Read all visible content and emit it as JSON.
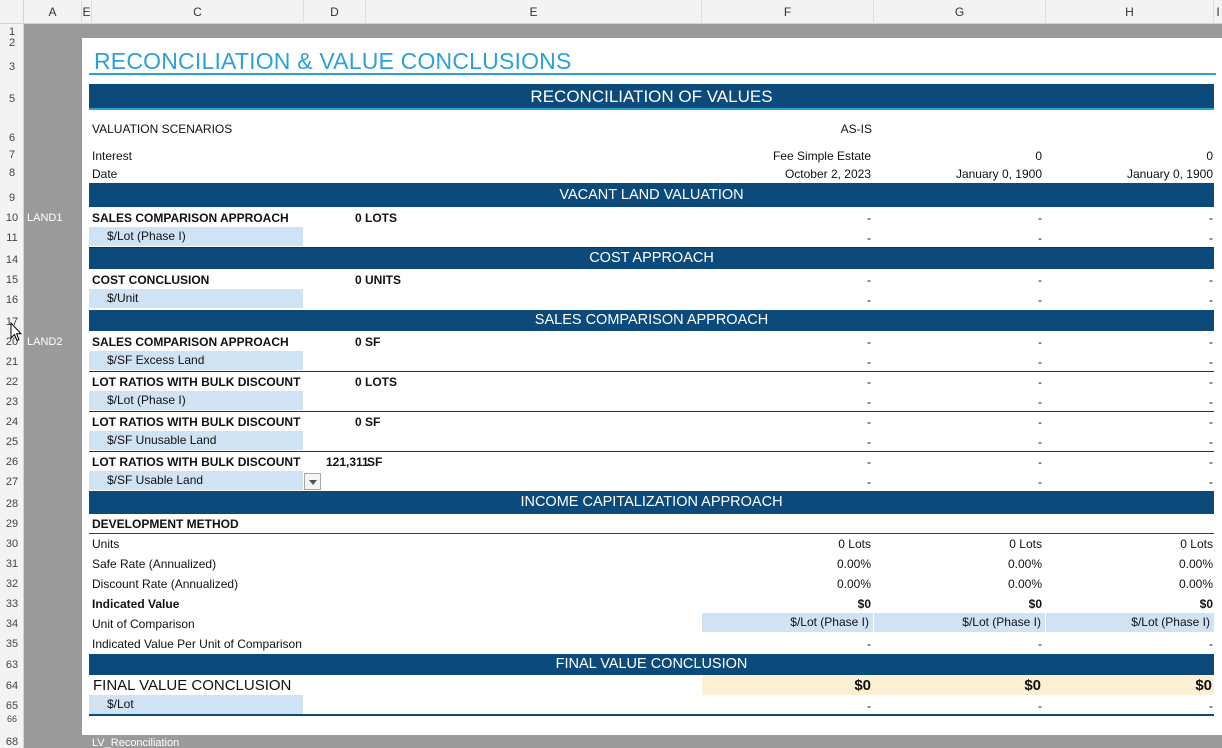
{
  "columns": [
    "A",
    "E",
    "C",
    "D",
    "E",
    "F",
    "G",
    "H",
    "I"
  ],
  "rows": [
    "1",
    "2",
    "3",
    "5",
    "6",
    "7",
    "8",
    "9",
    "10",
    "11",
    "14",
    "15",
    "16",
    "17",
    "20",
    "21",
    "22",
    "23",
    "24",
    "25",
    "26",
    "27",
    "28",
    "29",
    "30",
    "31",
    "32",
    "33",
    "34",
    "35",
    "63",
    "64",
    "65",
    "66",
    "68"
  ],
  "side_labels": {
    "land1": "LAND1",
    "land2": "LAND2"
  },
  "sheet_tab": "LV_Reconciliation",
  "title": "RECONCILIATION & VALUE CONCLUSIONS",
  "sections": {
    "reconciliation": "RECONCILIATION OF VALUES",
    "vacant_land": "VACANT LAND VALUATION",
    "cost": "COST APPROACH",
    "sales": "SALES COMPARISON APPROACH",
    "income": "INCOME CAPITALIZATION APPROACH",
    "final": "FINAL VALUE CONCLUSION"
  },
  "header": {
    "valuation_scenarios": "VALUATION SCENARIOS",
    "scenario": "AS-IS",
    "interest_label": "Interest",
    "interest": [
      "Fee Simple Estate",
      "0",
      "0"
    ],
    "date_label": "Date",
    "dates": [
      "October 2, 2023",
      "January 0, 1900",
      "January 0, 1900"
    ]
  },
  "dash": "-",
  "vacant": {
    "label": "SALES COMPARISON APPROACH",
    "qty": "0 LOTS",
    "unit": "$/Lot (Phase I)"
  },
  "cost": {
    "label": "COST CONCLUSION",
    "qty": "0 UNITS",
    "unit": "$/Unit"
  },
  "sales": [
    {
      "label": "SALES COMPARISON APPROACH",
      "qty": "0 SF",
      "unit": "$/SF Excess Land"
    },
    {
      "label": "LOT RATIOS WITH BULK DISCOUNT",
      "qty": "0 LOTS",
      "unit": "$/Lot (Phase I)"
    },
    {
      "label": "LOT RATIOS WITH BULK DISCOUNT",
      "qty": "0 SF",
      "unit": "$/SF Unusable Land"
    },
    {
      "label": "LOT RATIOS WITH BULK DISCOUNT",
      "qty_num": "121,311",
      "qty_unit": "SF",
      "unit": "$/SF Usable Land"
    }
  ],
  "income": {
    "method": "DEVELOPMENT METHOD",
    "units_label": "Units",
    "units": [
      "0 Lots",
      "0 Lots",
      "0 Lots"
    ],
    "safe_label": "Safe Rate (Annualized)",
    "safe": [
      "0.00%",
      "0.00%",
      "0.00%"
    ],
    "discount_label": "Discount Rate (Annualized)",
    "discount": [
      "0.00%",
      "0.00%",
      "0.00%"
    ],
    "indicated_label": "Indicated Value",
    "indicated": [
      "$0",
      "$0",
      "$0"
    ],
    "uoc_label": "Unit of Comparison",
    "uoc": [
      "$/Lot (Phase I)",
      "$/Lot (Phase I)",
      "$/Lot (Phase I)"
    ],
    "ivpu_label": "Indicated Value Per Unit of Comparison"
  },
  "final": {
    "label": "FINAL VALUE CONCLUSION",
    "values": [
      "$0",
      "$0",
      "$0"
    ],
    "unit": "$/Lot"
  },
  "colors": {
    "band": "#0b4a7a",
    "accent": "#2ea0d8",
    "input_fill": "#cfe3f4",
    "final_fill": "#fdf0d5"
  }
}
